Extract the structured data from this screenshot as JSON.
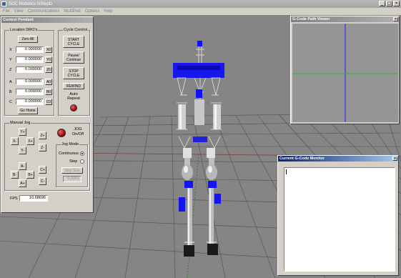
{
  "window": {
    "title": "SOC Robotics GStepD"
  },
  "menu": [
    "File",
    "View",
    "Communications",
    "MultiPod",
    "Options",
    "Help"
  ],
  "control_pendant": {
    "title": "Control Pendant",
    "location_label": "Location DRO's",
    "zero_all": "Zero All",
    "axes": [
      {
        "label": "X",
        "value": "0.000000",
        "zero": "X0"
      },
      {
        "label": "Y",
        "value": "0.000000",
        "zero": "Y0"
      },
      {
        "label": "Z",
        "value": "0.000000",
        "zero": "Z0"
      },
      {
        "label": "A",
        "value": "0.000000",
        "zero": "A0"
      },
      {
        "label": "B",
        "value": "0.000000",
        "zero": "B0"
      },
      {
        "label": "C",
        "value": "0.000000",
        "zero": "C0"
      }
    ],
    "go_home": "Go Home",
    "cycle_control": "Cycle Control",
    "start_cycle": "START CYCLE",
    "pause": "Pause/ Continue",
    "stop_cycle": "STOP CYCLE",
    "rewind": "REWIND",
    "auto_repeat": "Auto Repeat",
    "manual_jog": "Manual Jog",
    "jog": {
      "yplus": "Y+",
      "yminus": "Y-",
      "xminus": "X-",
      "xplus": "X+",
      "zplus": "Z+",
      "zminus": "Z-",
      "aminus": "A-",
      "aplus": "A+",
      "bminus": "B-",
      "bplus": "B+",
      "cplus": "C+",
      "cminus": "C-"
    },
    "jog_onoff": "JOG On/Off",
    "jog_mode": "Jog Mode",
    "continuous": "Continuous",
    "step": "Step",
    "step_size": "Step Size",
    "step_value": "0.0001",
    "fps_label": "FPS",
    "fps_value": "10.68696"
  },
  "path_viewer": {
    "title": "G-Code Path Viewer"
  },
  "monitor": {
    "title": "Current G-Code Monitor"
  }
}
